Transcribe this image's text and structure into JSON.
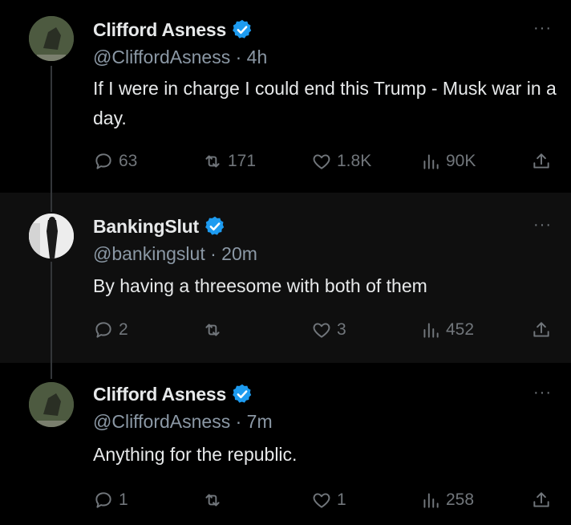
{
  "tweets": [
    {
      "name": "Clifford Asness",
      "handle": "@CliffordAsness",
      "time": "4h",
      "text": "If I were in charge I could end this Trump - Musk war in a day.",
      "replies": "63",
      "retweets": "171",
      "likes": "1.8K",
      "views": "90K",
      "icons": [
        "reply-icon",
        "retweet-icon",
        "like-icon",
        "views-icon",
        "share-icon"
      ]
    },
    {
      "name": "BankingSlut",
      "handle": "@bankingslut",
      "time": "20m",
      "text": "By having a threesome with both of them",
      "replies": "2",
      "retweets": "",
      "likes": "3",
      "views": "452"
    },
    {
      "name": "Clifford Asness",
      "handle": "@CliffordAsness",
      "time": "7m",
      "text": "Anything for the republic.",
      "replies": "1",
      "retweets": "",
      "likes": "1",
      "views": "258"
    }
  ],
  "separator": "·",
  "more_label": "···",
  "colors": {
    "verified": "#1d9bf0",
    "muted": "#71767b",
    "background": "#000000",
    "highlight": "#0f0f0f"
  }
}
